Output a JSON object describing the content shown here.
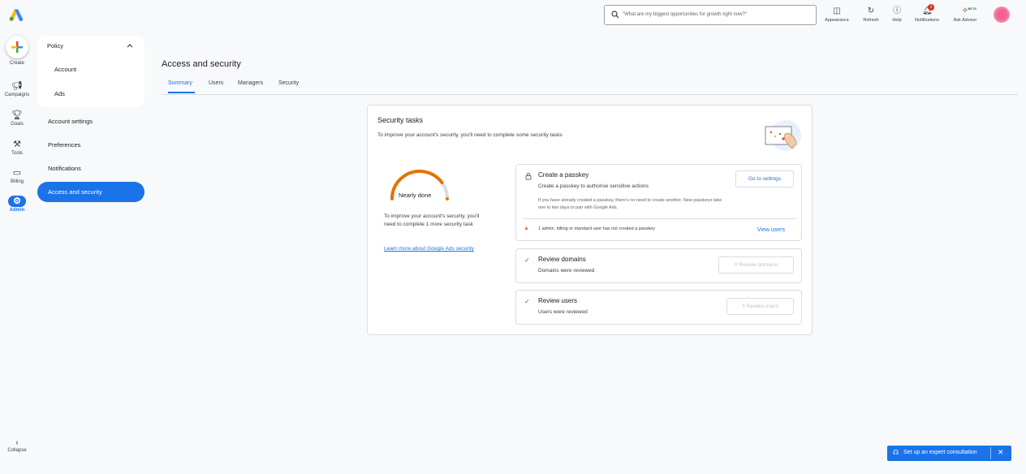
{
  "rail": {
    "create": "Create",
    "campaigns": "Campaigns",
    "goals": "Goals",
    "tools": "Tools",
    "billing": "Billing",
    "admin": "Admin",
    "collapse": "Collapse"
  },
  "subnav": {
    "policy": "Policy",
    "account": "Account",
    "ads": "Ads",
    "account_settings": "Account settings",
    "preferences": "Preferences",
    "notifications": "Notifications",
    "access_security": "Access and security"
  },
  "topbar": {
    "search_placeholder": "\"What are my biggest opportunities for growth right now?\"",
    "appearance": "Appearance",
    "refresh": "Refresh",
    "help": "Help",
    "notifications": "Notifications",
    "notifications_count": "1",
    "ask_advisor": "Ask Advisor",
    "beta": "BETA"
  },
  "page": {
    "title": "Access and security",
    "tabs": [
      "Summary",
      "Users",
      "Managers",
      "Security"
    ]
  },
  "card": {
    "title": "Security tasks",
    "subtitle": "To improve your account's security, you'll need to complete some security tasks",
    "gauge_label": "Nearly done",
    "gauge_progress": 0.8,
    "left_text": "To improve your account's security, you'll need to complete 1 more security task",
    "learn_link": "Learn more about Google Ads security",
    "tasks": [
      {
        "title": "Create a passkey",
        "subtitle": "Create a passkey to authorise sensitive actions",
        "note": "If you have already created a passkey, there's no need to create another. New passkeys take one to two days to pair with Google Ads.",
        "warning": "1 admin, billing or standard user has not created a passkey",
        "link": "View users",
        "button": "Go to settings"
      },
      {
        "title": "Review domains",
        "subtitle": "Domains were reviewed",
        "button": "Review domains"
      },
      {
        "title": "Review users",
        "subtitle": "Users were reviewed",
        "button": "Review users"
      }
    ]
  },
  "consult": {
    "label": "Set up an expert consultation"
  },
  "colors": {
    "accent": "#1a73e8",
    "success": "#1e8e3e",
    "warning": "#e37400",
    "gauge": "#e37400"
  }
}
